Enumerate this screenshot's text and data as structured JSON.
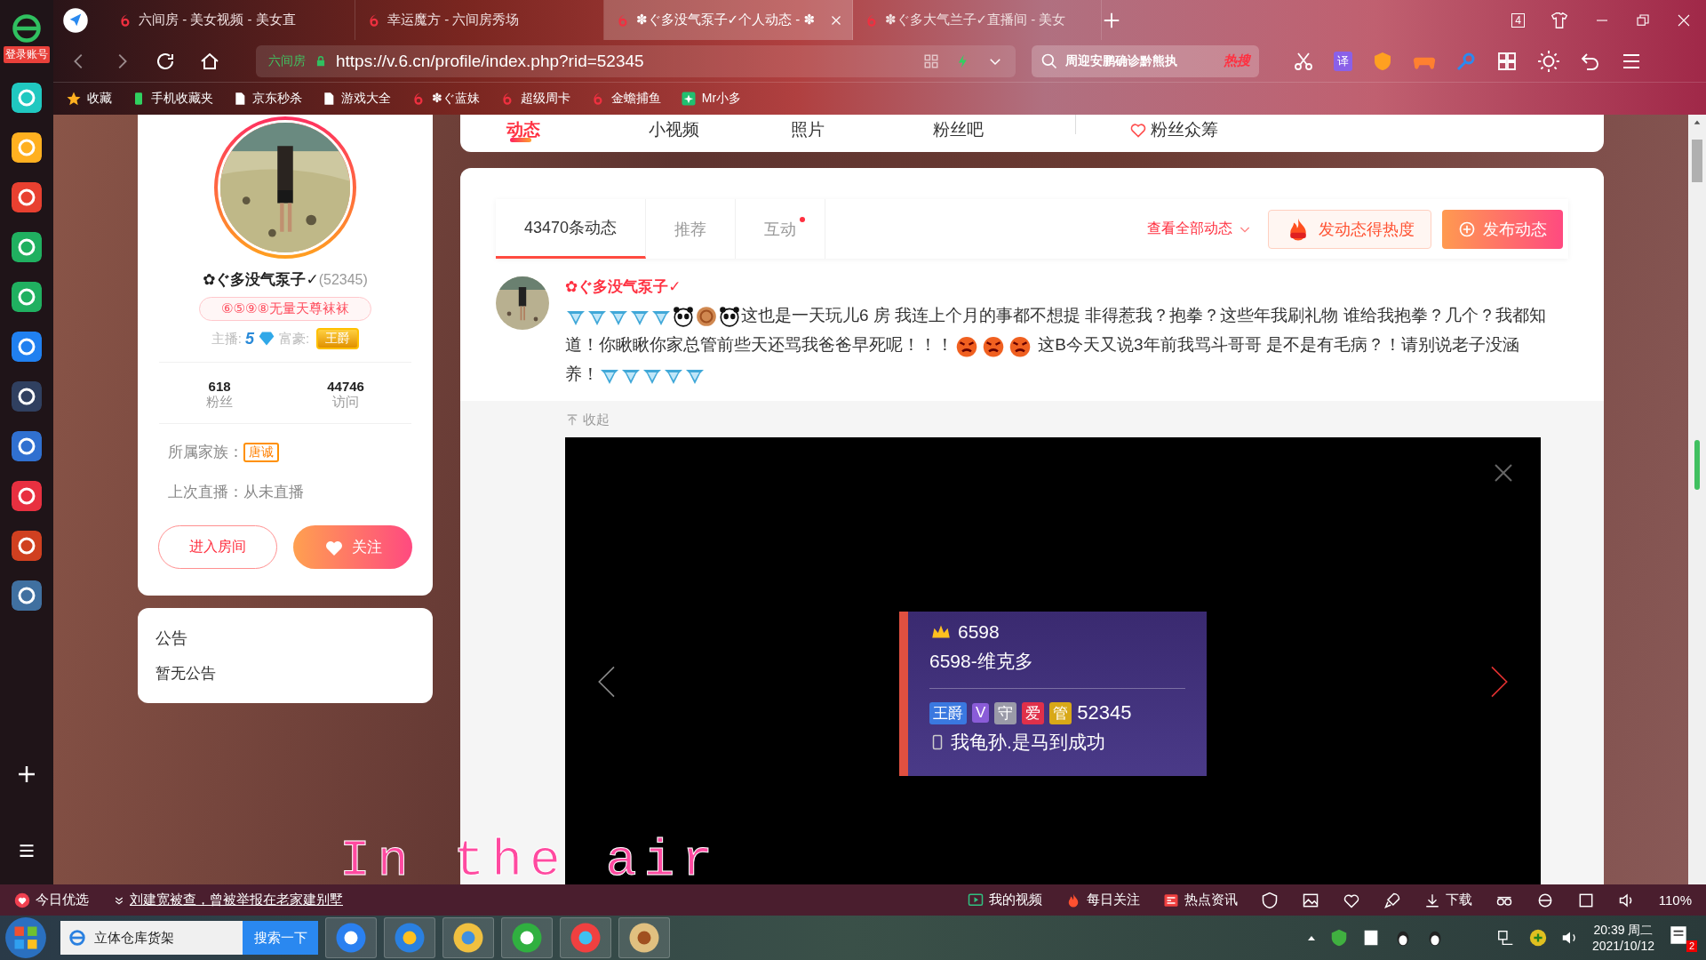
{
  "browser": {
    "login_label": "登录账号",
    "tabs": [
      {
        "title": "六间房 - 美女视频 - 美女直",
        "selected": false
      },
      {
        "title": "幸运魔方 - 六间房秀场",
        "selected": false
      },
      {
        "title": "✽ぐ多没气泵子✓个人动态 - ✽",
        "selected": true
      },
      {
        "title": "✽ぐ多大气兰子✓直播间 - 美女",
        "selected": false
      }
    ],
    "tab_count": "4",
    "address": {
      "site_label": "六间房",
      "url": "https://v.6.cn/profile/index.php?rid=52345"
    },
    "search": {
      "value": "周迎安鹏确诊黔熊执",
      "hot_label": "热搜"
    },
    "translate_label": "译",
    "bookmarks": [
      {
        "label": "收藏",
        "kind": "star"
      },
      {
        "label": "手机收藏夹",
        "kind": "phone"
      },
      {
        "label": "京东秒杀",
        "kind": "page"
      },
      {
        "label": "游戏大全",
        "kind": "page"
      },
      {
        "label": "✽ぐ蓝妹",
        "kind": "six"
      },
      {
        "label": "超级周卡",
        "kind": "six"
      },
      {
        "label": "金蟾捕鱼",
        "kind": "six"
      },
      {
        "label": "Mr小多",
        "kind": "app"
      }
    ]
  },
  "profile": {
    "name": "✿ぐ多没气泵子✓",
    "id": "(52345)",
    "title_badge": "⑥⑤⑨⑧无量天尊袜袜",
    "anchor_label": "主播:",
    "anchor_level": "5",
    "rich_label": "富豪:",
    "rich_badge": "王爵",
    "stats": [
      {
        "value": "618",
        "label": "粉丝"
      },
      {
        "value": "44746",
        "label": "访问"
      }
    ],
    "family_label": "所属家族：",
    "family_badge": "唐诚",
    "last_live": "上次直播：从未直播",
    "enter_button": "进入房间",
    "follow_button": "关注"
  },
  "announcement": {
    "title": "公告",
    "text": "暂无公告"
  },
  "nav_tabs": [
    {
      "label": "动态",
      "selected": true
    },
    {
      "label": "小视频",
      "selected": false
    },
    {
      "label": "照片",
      "selected": false
    },
    {
      "label": "粉丝吧",
      "selected": false
    },
    {
      "label": "粉丝众筹",
      "selected": false
    }
  ],
  "feed": {
    "tabs": [
      {
        "label": "43470条动态",
        "selected": true,
        "dot": false
      },
      {
        "label": "推荐",
        "selected": false,
        "dot": false
      },
      {
        "label": "互动",
        "selected": false,
        "dot": true
      }
    ],
    "view_all": "查看全部动态",
    "hot_button": "发动态得热度",
    "publish_button": "发布动态",
    "post": {
      "author": "✿ぐ多没气泵子✓",
      "content": [
        {
          "kind": "badge"
        },
        {
          "kind": "badge"
        },
        {
          "kind": "badge"
        },
        {
          "kind": "badge"
        },
        {
          "kind": "badge"
        },
        {
          "kind": "panda"
        },
        {
          "kind": "coin"
        },
        {
          "kind": "panda"
        },
        {
          "kind": "text",
          "text": "这也是一天玩儿6 房 我连上个月的事都不想提 非得惹我？抱拳？这些年我刷礼物 谁给我抱拳？几个？我都知道！你瞅瞅你家总管前些天还骂我爸爸早死呢！！！"
        },
        {
          "kind": "angry"
        },
        {
          "kind": "angry"
        },
        {
          "kind": "angry"
        },
        {
          "kind": "text",
          "text": " 这B今天又说3年前我骂斗哥哥 是不是有毛病？！请别说老子没涵养！"
        },
        {
          "kind": "badge"
        },
        {
          "kind": "badge"
        },
        {
          "kind": "badge"
        },
        {
          "kind": "badge"
        },
        {
          "kind": "badge"
        }
      ],
      "collapse": "收起",
      "image_card": {
        "level": "6598",
        "name": "6598-维克多",
        "badges": [
          {
            "label": "王爵",
            "color": "#3a78e0"
          },
          {
            "label": "V",
            "color": "#8a5cd8"
          },
          {
            "label": "守",
            "color": "#9a9aa8"
          },
          {
            "label": "爱",
            "color": "#e0304a"
          },
          {
            "label": "管",
            "color": "#d8a818"
          }
        ],
        "id": "52345",
        "signature": "我龟孙.是马到成功"
      }
    }
  },
  "lyrics": "In the air",
  "status_bar": {
    "daily": "今日优选",
    "news": "刘建宽被查，曾被举报在老家建别墅",
    "links": [
      {
        "label": "我的视频",
        "kind": "video"
      },
      {
        "label": "每日关注",
        "kind": "fire"
      },
      {
        "label": "热点资讯",
        "kind": "news"
      }
    ],
    "download": "下载",
    "zoom": "110%"
  },
  "taskbar": {
    "search_value": "立体仓库货架",
    "search_button": "搜索一下",
    "time": "20:39 周二",
    "date": "2021/10/12",
    "notifications": "2"
  }
}
